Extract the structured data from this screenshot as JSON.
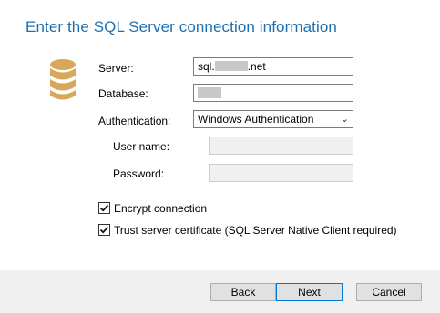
{
  "header": {
    "title": "Enter the SQL Server connection information"
  },
  "icons": {
    "database": "database-icon",
    "checkmark": "checkmark-icon",
    "dropdown": "chevron-down-icon"
  },
  "form": {
    "server_label": "Server:",
    "server_prefix": "sql.",
    "server_suffix": ".net",
    "database_label": "Database:",
    "authentication_label": "Authentication:",
    "authentication_value": "Windows Authentication",
    "chevron": "⌄",
    "username_label": "User name:",
    "username_value": "",
    "password_label": "Password:",
    "password_value": ""
  },
  "options": {
    "encrypt_label": "Encrypt connection",
    "encrypt_checked": true,
    "trust_label": "Trust server certificate (SQL Server Native Client required)",
    "trust_checked": true
  },
  "buttons": {
    "back": "Back",
    "next": "Next",
    "cancel": "Cancel"
  },
  "colors": {
    "title": "#1e6fb0",
    "icon": "#d9a75a",
    "default_button_border": "#0078d7"
  }
}
